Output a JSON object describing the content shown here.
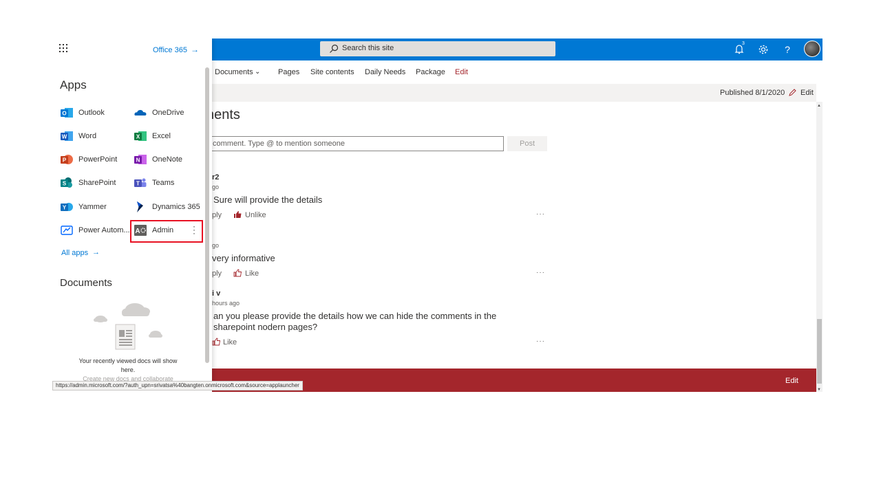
{
  "suitebar": {
    "search_placeholder": "Search this site",
    "notification_count": "3",
    "accent": "#0078d4"
  },
  "sitenav": {
    "items": [
      "Documents",
      "Pages",
      "Site contents",
      "Daily Needs",
      "Package",
      "Edit"
    ]
  },
  "commandbar": {
    "published": "Published 8/1/2020",
    "edit_label": "Edit"
  },
  "comments": {
    "title": "nents",
    "input_placeholder": "comment. Type @ to mention someone",
    "post_label": "Post",
    "list": [
      {
        "name": "r2",
        "time": "go",
        "text": "Sure will provide the details",
        "reply": "ply",
        "like": "Unlike"
      },
      {
        "name": "",
        "time": "go",
        "text": "very informative",
        "reply": "ply",
        "like": "Like"
      },
      {
        "name": "i v",
        "time": "hours ago",
        "text": "an you please provide the details how we can hide the comments in the sharepoint nodern pages?",
        "reply": "",
        "like": "Like"
      }
    ],
    "more": "···"
  },
  "footer": {
    "edit_label": "Edit",
    "color": "#a4262c"
  },
  "launcher": {
    "office365": "Office 365",
    "apps_heading": "Apps",
    "apps": [
      {
        "label": "Outlook",
        "icon": "outlook-icon",
        "color": "#0078d4"
      },
      {
        "label": "OneDrive",
        "icon": "onedrive-icon",
        "color": "#0364b8"
      },
      {
        "label": "Word",
        "icon": "word-icon",
        "color": "#185abd"
      },
      {
        "label": "Excel",
        "icon": "excel-icon",
        "color": "#107c41"
      },
      {
        "label": "PowerPoint",
        "icon": "powerpoint-icon",
        "color": "#c43e1c"
      },
      {
        "label": "OneNote",
        "icon": "onenote-icon",
        "color": "#7719aa"
      },
      {
        "label": "SharePoint",
        "icon": "sharepoint-icon",
        "color": "#038387"
      },
      {
        "label": "Teams",
        "icon": "teams-icon",
        "color": "#4b53bc"
      },
      {
        "label": "Yammer",
        "icon": "yammer-icon",
        "color": "#106ebe"
      },
      {
        "label": "Dynamics 365",
        "icon": "dynamics-icon",
        "color": "#002050"
      },
      {
        "label": "Power Autom...",
        "icon": "power-automate-icon",
        "color": "#0066ff"
      },
      {
        "label": "Admin",
        "icon": "admin-icon",
        "color": "#605e5c"
      }
    ],
    "all_apps": "All apps",
    "documents_heading": "Documents",
    "docs_empty": "Your recently viewed docs will show here.",
    "docs_empty_sub": "Create new docs and collaborate"
  },
  "status_url": "https://admin.microsoft.com/?auth_upn=srivatsa%40bangten.onmicrosoft.com&source=applauncher"
}
